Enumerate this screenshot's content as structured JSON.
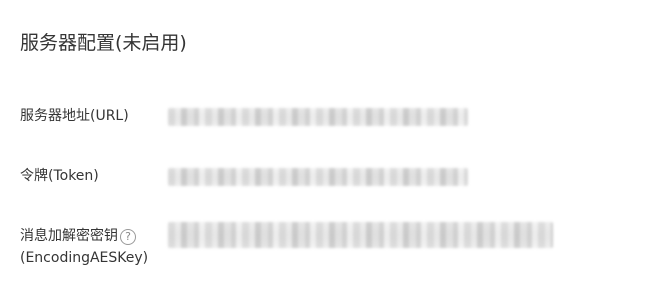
{
  "section": {
    "title": "服务器配置(未启用)"
  },
  "fields": [
    {
      "label": "服务器地址(URL)",
      "value": ""
    },
    {
      "label": "令牌(Token)",
      "value": ""
    },
    {
      "label": "消息加解密密钥",
      "label_sub": "(EncodingAESKey)",
      "help": "?",
      "value": ""
    }
  ],
  "icons": {
    "help": "question-circle-icon"
  },
  "colors": {
    "text": "#353535",
    "help_icon": "#9a9a9a",
    "background": "#ffffff"
  }
}
